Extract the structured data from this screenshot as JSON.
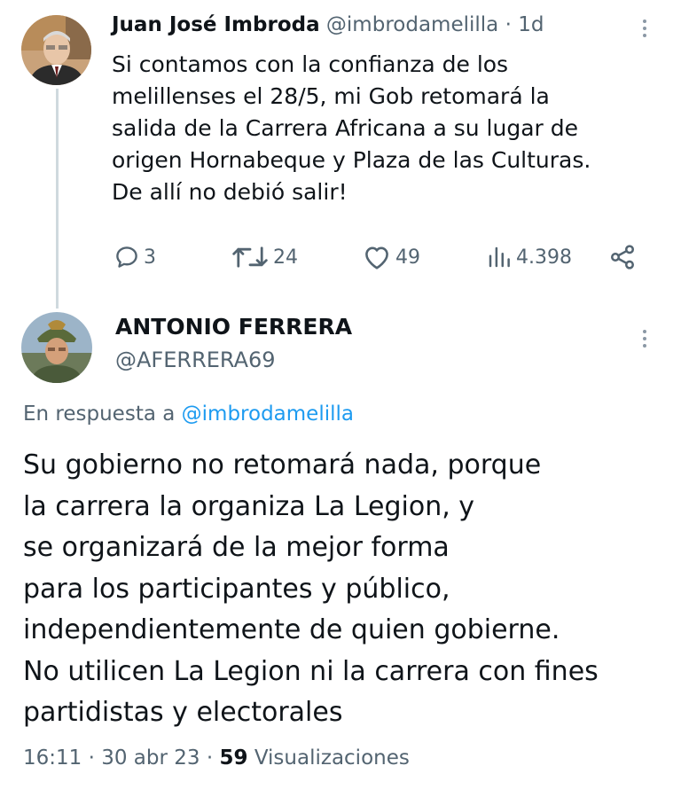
{
  "parent_tweet": {
    "author_name": "Juan José Imbroda",
    "author_handle": "@imbrodamelilla",
    "separator": "·",
    "time_ago": "1d",
    "text": "Si contamos con la confianza de los\nmelillenses el 28/5, mi Gob retomará la\nsalida de la Carrera Africana a su lugar de\norigen Hornabeque y Plaza de las Culturas.\nDe allí no debió salir!",
    "actions": {
      "replies": "3",
      "retweets": "24",
      "likes": "49",
      "views": "4.398"
    }
  },
  "reply_tweet": {
    "author_name": "ANTONIO FERRERA",
    "author_handle": "@AFERRERA69",
    "in_reply_to_prefix": "En respuesta a",
    "in_reply_to_handle": "@imbrodamelilla",
    "text_lines": [
      "Su gobierno no retomará nada, porque",
      "la carrera la organiza La Legion, y",
      "se organizará de la mejor forma",
      "para los participantes y público,",
      "independientemente de quien gobierne.",
      "No utilicen La Legion ni la carrera con fines",
      "partidistas y electorales"
    ],
    "time": "16:11",
    "date": "30 abr 23",
    "dot": "·",
    "views_count": "59",
    "views_label": "Visualizaciones"
  },
  "colors": {
    "text": "#0f1419",
    "secondary": "#536471",
    "link": "#1d9bf0",
    "thread_line": "#cfd9de"
  },
  "icons": [
    "reply-icon",
    "retweet-icon",
    "like-icon",
    "views-icon",
    "share-icon",
    "more-options-icon"
  ]
}
